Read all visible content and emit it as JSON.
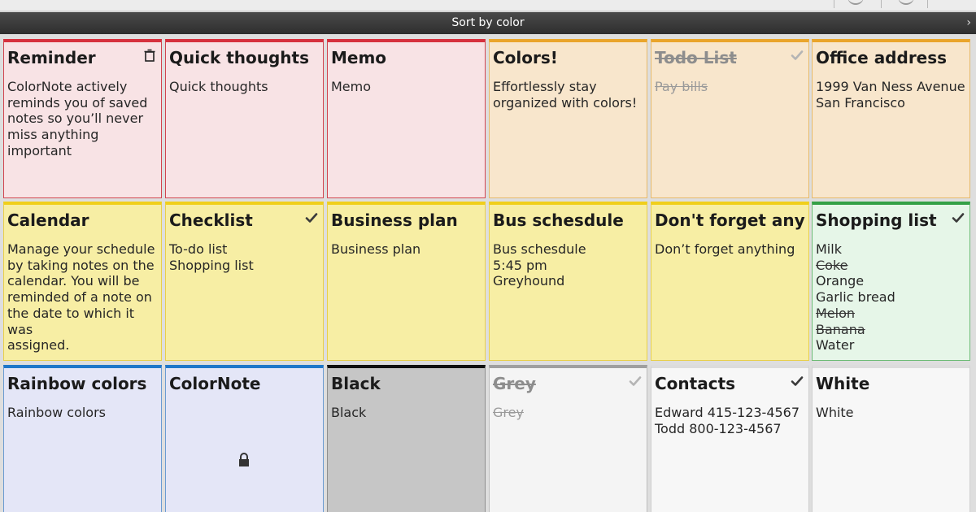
{
  "header": {
    "sort_label": "Sort by color"
  },
  "colors": {
    "red": "#d6313e",
    "orange": "#eaa52b",
    "yellow": "#f0cf1b",
    "green": "#34a046",
    "blue": "#1f77c9",
    "black": "#111111",
    "grey": "#9f9f9f",
    "white": "#dcdcdc"
  },
  "notes": [
    {
      "title": "Reminder",
      "color": "red",
      "status": "trash-icon",
      "lines": [
        {
          "text": "ColorNote actively"
        },
        {
          "text": "reminds you of saved"
        },
        {
          "text": "notes so you’ll never"
        },
        {
          "text": "miss anything important"
        }
      ]
    },
    {
      "title": "Quick thoughts",
      "color": "red",
      "lines": [
        {
          "text": "Quick thoughts"
        }
      ]
    },
    {
      "title": "Memo",
      "color": "red",
      "lines": [
        {
          "text": "Memo"
        }
      ]
    },
    {
      "title": "Colors!",
      "color": "orange",
      "lines": [
        {
          "text": "Effortlessly stay"
        },
        {
          "text": "organized with colors!"
        }
      ]
    },
    {
      "title": "Todo List",
      "color": "orange",
      "done": true,
      "status": "check-icon",
      "lines": [
        {
          "text": "Pay bills"
        }
      ]
    },
    {
      "title": "Office address",
      "color": "orange",
      "lines": [
        {
          "text": "1999 Van Ness Avenue"
        },
        {
          "text": "San Francisco"
        }
      ]
    },
    {
      "title": "Calendar",
      "color": "yellow",
      "lines": [
        {
          "text": "Manage your schedule"
        },
        {
          "text": "by taking notes on the"
        },
        {
          "text": "calendar. You will be"
        },
        {
          "text": "reminded of a note on"
        },
        {
          "text": "the date to which it was"
        },
        {
          "text": "assigned."
        }
      ]
    },
    {
      "title": "Checklist",
      "color": "yellow",
      "status": "check-icon",
      "lines": [
        {
          "text": "To-do list"
        },
        {
          "text": "Shopping list"
        }
      ]
    },
    {
      "title": "Business plan",
      "color": "yellow",
      "lines": [
        {
          "text": "Business plan"
        }
      ]
    },
    {
      "title": "Bus schesdule",
      "color": "yellow",
      "lines": [
        {
          "text": "Bus schesdule"
        },
        {
          "text": "5:45 pm"
        },
        {
          "text": "Greyhound"
        }
      ]
    },
    {
      "title": "Don't forget anything",
      "color": "yellow",
      "lines": [
        {
          "text": "Don’t forget anything"
        }
      ]
    },
    {
      "title": "Shopping list",
      "color": "green",
      "status": "check-icon",
      "lines": [
        {
          "text": "Milk"
        },
        {
          "text": "Coke",
          "done": true
        },
        {
          "text": "Orange"
        },
        {
          "text": "Garlic bread"
        },
        {
          "text": "Melon",
          "done": true
        },
        {
          "text": "Banana",
          "done": true
        },
        {
          "text": "Water"
        }
      ]
    },
    {
      "title": "Rainbow colors",
      "color": "blue",
      "lines": [
        {
          "text": "Rainbow colors"
        }
      ]
    },
    {
      "title": "ColorNote",
      "color": "blue",
      "locked": true,
      "lines": []
    },
    {
      "title": "Black",
      "color": "black",
      "lines": [
        {
          "text": "Black"
        }
      ]
    },
    {
      "title": "Grey",
      "color": "grey",
      "done": true,
      "status": "check-icon",
      "lines": [
        {
          "text": "Grey"
        }
      ]
    },
    {
      "title": "Contacts",
      "color": "white",
      "status": "check-icon",
      "lines": [
        {
          "text": "Edward 415-123-4567"
        },
        {
          "text": "Todd 800-123-4567"
        }
      ]
    },
    {
      "title": "White",
      "color": "white",
      "lines": [
        {
          "text": "White"
        }
      ]
    }
  ]
}
